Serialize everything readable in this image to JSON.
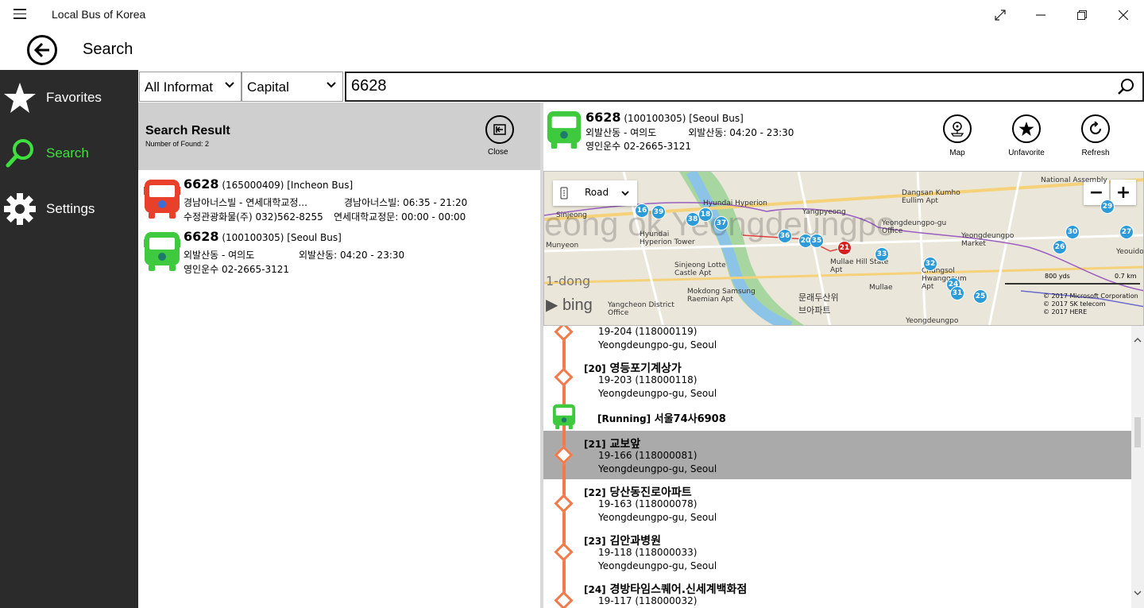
{
  "window": {
    "title": "Local Bus of Korea"
  },
  "header": {
    "title": "Search"
  },
  "sidebar": {
    "items": [
      {
        "label": "Favorites",
        "icon": "star-icon"
      },
      {
        "label": "Search",
        "icon": "search-icon"
      },
      {
        "label": "Settings",
        "icon": "gear-icon"
      }
    ],
    "active_color": "#3de03d"
  },
  "search": {
    "type_value": "All Informat",
    "region_value": "Capital",
    "query": "6628"
  },
  "results": {
    "title": "Search Result",
    "count_text": "Number of Found: 2",
    "close_label": "Close",
    "items": [
      {
        "number": "6628",
        "meta": "(165000409)  [Incheon Bus]",
        "route": "경남아너스빌 - 연세대학교정...",
        "route_time": "경남아너스빌: 06:35 - 21:20",
        "company": "수정관광화물(주) 032)562-8255",
        "company_time": "연세대학교정문: 00:00 - 00:00",
        "color": "#e8402b"
      },
      {
        "number": "6628",
        "meta": "(100100305)  [Seoul Bus]",
        "route": "외발산동 - 여의도",
        "route_time": "외발산동: 04:20 - 23:30",
        "company": "영인운수 02-2665-3121",
        "company_time": "",
        "color": "#3fc93f"
      }
    ]
  },
  "detail": {
    "number": "6628",
    "meta": "(100100305) [Seoul Bus]",
    "route": "외발산동 - 여의도",
    "route_time": "외발산동: 04:20 - 23:30",
    "company": "영인운수",
    "phone": "02-2665-3121",
    "actions": {
      "map": "Map",
      "unfavorite": "Unfavorite",
      "refresh": "Refresh"
    }
  },
  "map": {
    "mode": "Road",
    "scale_yds": "800 yds",
    "scale_km": "0.7 km",
    "brand": "bing",
    "copyright": [
      "© 2017 Microsoft Corporation",
      "© 2017 SK telecom",
      "© 2017 HERE"
    ],
    "places": [
      "Hyundai Hyperion",
      "Dangsan Kumho Eullim Apt",
      "Yangpyeong",
      "Yeongdeungpo-gu Office",
      "Yeongdeungpo Market",
      "Hyundai Hyperion Tower",
      "Sinjeong Lotte Castle Apt",
      "Mullae Hill State Apt",
      "Mullae",
      "Chungsol Hwanggeum Apt",
      "Mokdong Samsung Raemian Apt",
      "Yangcheon District Office",
      "문래두산위브아파트",
      "Yeongdeungpo",
      "National Assembly",
      "Yeouido",
      "1-dong",
      "Sinjeong",
      "Munyeon"
    ],
    "watermark": "eong ok   Yeongdeungpo",
    "stops": [
      "16",
      "39",
      "38",
      "18",
      "37",
      "36",
      "20",
      "35",
      "21",
      "33",
      "32",
      "24",
      "31",
      "25",
      "29",
      "30",
      "26",
      "27"
    ],
    "highlight_stop": "21",
    "colors": {
      "stop": "#2d9bd8",
      "highlight": "#d42020"
    }
  },
  "stops": {
    "partial_top": {
      "code": "19-204 (118000119)",
      "area": "Yeongdeungpo-gu, Seoul"
    },
    "items_before": [
      {
        "num": "[20]",
        "name": "영등포기계상가",
        "code": "19-203 (118000118)",
        "area": "Yeongdeungpo-gu, Seoul"
      }
    ],
    "running": {
      "tag": "[Running]",
      "plate": "서울74사6908"
    },
    "items_after": [
      {
        "num": "[21]",
        "name": "교보앞",
        "code": "19-166 (118000081)",
        "area": "Yeongdeungpo-gu, Seoul",
        "selected": true
      },
      {
        "num": "[22]",
        "name": "당산동진로아파트",
        "code": "19-163 (118000078)",
        "area": "Yeongdeungpo-gu, Seoul"
      },
      {
        "num": "[23]",
        "name": "김안과병원",
        "code": "19-118 (118000033)",
        "area": "Yeongdeungpo-gu, Seoul"
      },
      {
        "num": "[24]",
        "name": "경방타임스퀘어.신세계백화점",
        "code": "19-117 (118000032)",
        "area": ""
      }
    ],
    "route_color": "#f07a4a"
  }
}
